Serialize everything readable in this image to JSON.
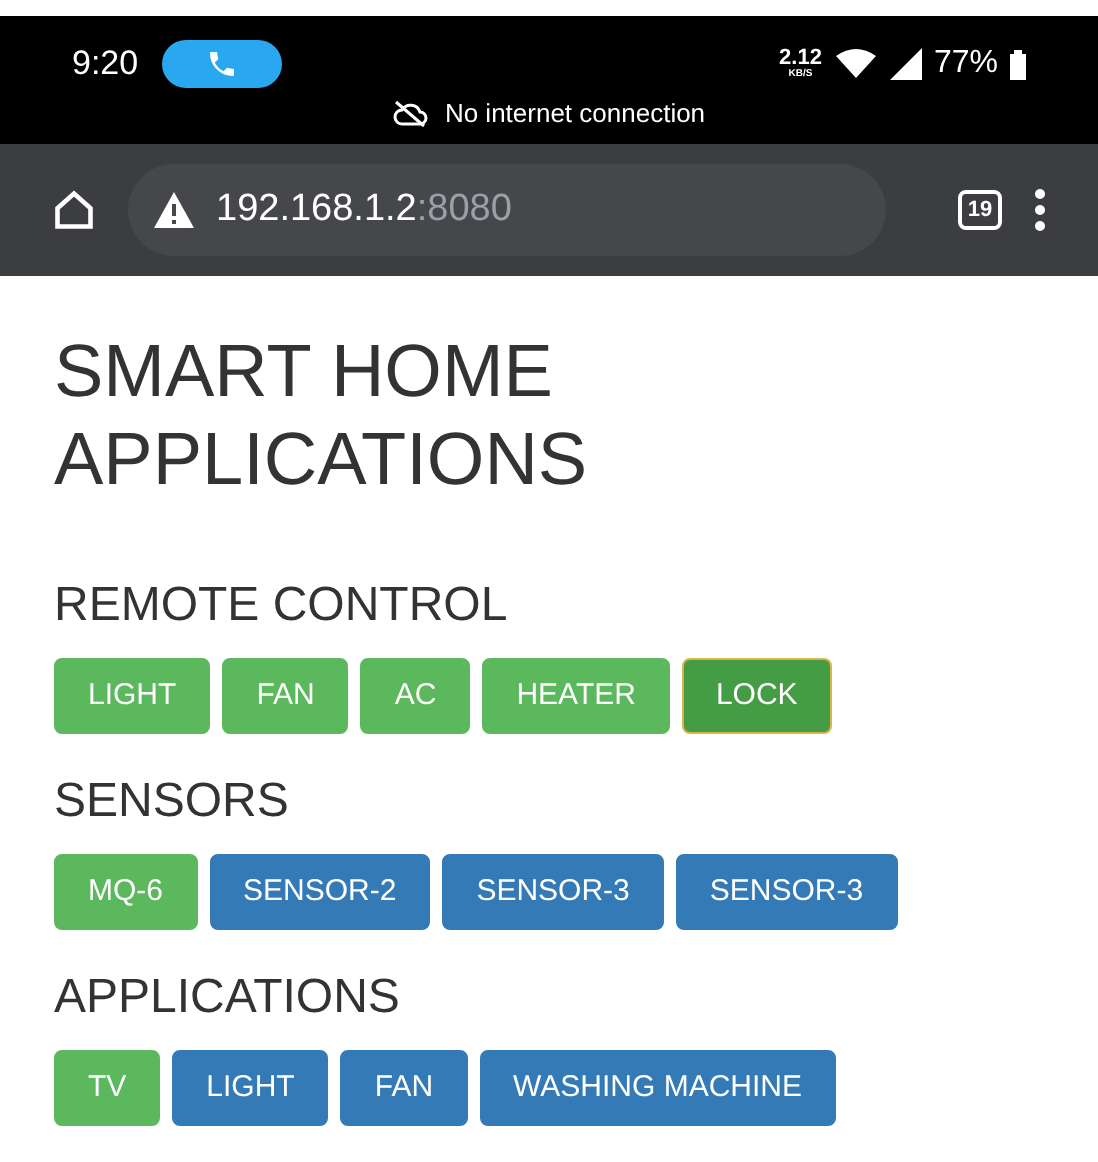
{
  "status_bar": {
    "time": "9:20",
    "speed_value": "2.12",
    "speed_unit": "KB/S",
    "battery": "77%",
    "notice": "No internet connection"
  },
  "browser": {
    "url_host": "192.168.1.2",
    "url_port": ":8080",
    "tab_count": "19"
  },
  "title": "SMART HOME APPLICATIONS",
  "sections": [
    {
      "heading": "REMOTE CONTROL",
      "buttons": [
        {
          "label": "LIGHT",
          "on": true,
          "focused": false
        },
        {
          "label": "FAN",
          "on": true,
          "focused": false
        },
        {
          "label": "AC",
          "on": true,
          "focused": false
        },
        {
          "label": "HEATER",
          "on": true,
          "focused": false
        },
        {
          "label": "LOCK",
          "on": true,
          "focused": true
        }
      ]
    },
    {
      "heading": "SENSORS",
      "buttons": [
        {
          "label": "MQ-6",
          "on": true,
          "focused": false
        },
        {
          "label": "SENSOR-2",
          "on": false,
          "focused": false
        },
        {
          "label": "SENSOR-3",
          "on": false,
          "focused": false
        },
        {
          "label": "SENSOR-3",
          "on": false,
          "focused": false
        }
      ]
    },
    {
      "heading": "APPLICATIONS",
      "buttons": [
        {
          "label": "TV",
          "on": true,
          "focused": false
        },
        {
          "label": "LIGHT",
          "on": false,
          "focused": false
        },
        {
          "label": "FAN",
          "on": false,
          "focused": false
        },
        {
          "label": "WASHING MACHINE",
          "on": false,
          "focused": false
        }
      ]
    }
  ]
}
